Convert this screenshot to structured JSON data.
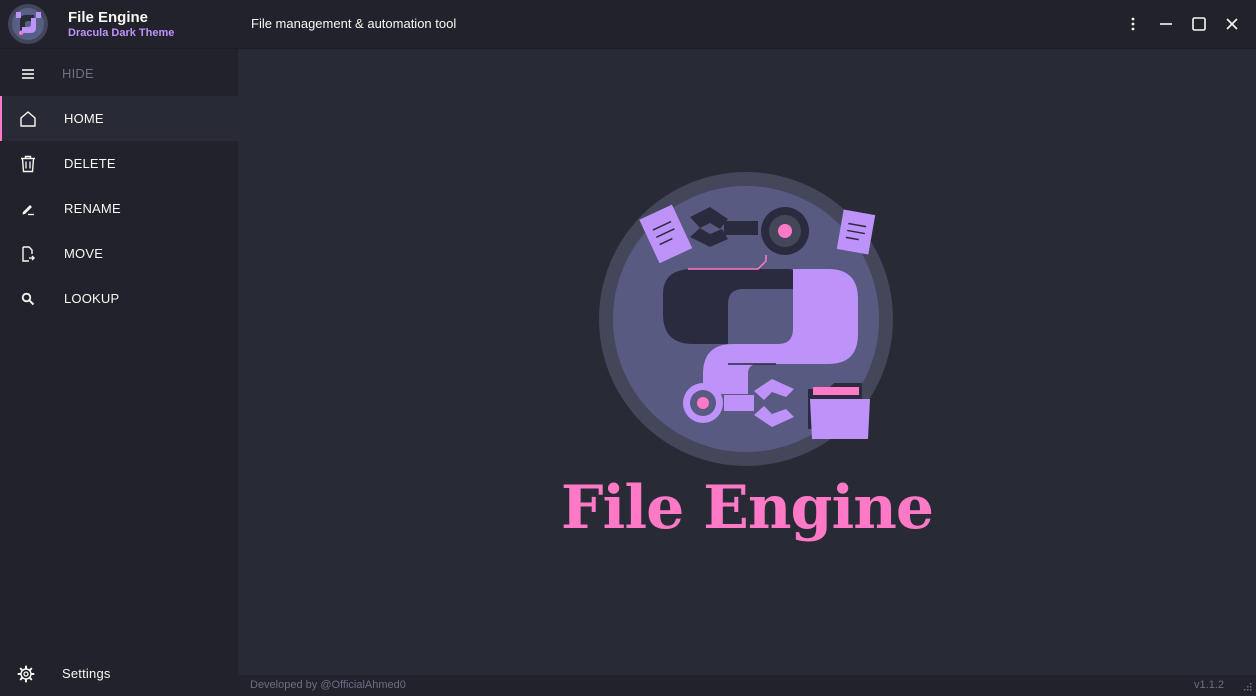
{
  "app": {
    "title": "File Engine",
    "subtitle": "Dracula Dark Theme",
    "description": "File management & automation tool"
  },
  "window_controls": [
    "more-options",
    "minimize",
    "maximize",
    "close"
  ],
  "sidebar": {
    "toggle_label": "HIDE",
    "items": [
      {
        "label": "HOME",
        "icon": "home-icon",
        "active": true
      },
      {
        "label": "DELETE",
        "icon": "trash-icon",
        "active": false
      },
      {
        "label": "RENAME",
        "icon": "edit-icon",
        "active": false
      },
      {
        "label": "MOVE",
        "icon": "file-move-icon",
        "active": false
      },
      {
        "label": "LOOKUP",
        "icon": "search-icon",
        "active": false
      }
    ],
    "settings_label": "Settings"
  },
  "main": {
    "hero_title": "File Engine"
  },
  "status": {
    "credit": "Developed by @OfficialAhmed0",
    "version": "v1.1.2"
  },
  "colors": {
    "background": "#282a36",
    "panel": "#21222c",
    "accent_pink": "#ff79c6",
    "accent_purple": "#bd93f9",
    "muted": "#6c6f85",
    "text": "#f8f8f2"
  }
}
